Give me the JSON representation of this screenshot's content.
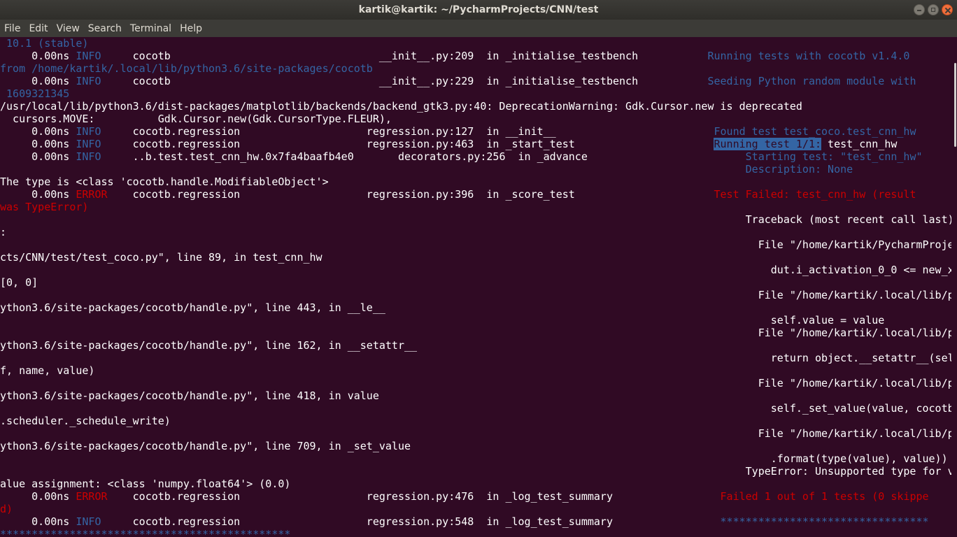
{
  "window": {
    "title": "kartik@kartik: ~/PycharmProjects/CNN/test"
  },
  "menu": [
    "File",
    "Edit",
    "View",
    "Search",
    "Terminal",
    "Help"
  ],
  "terminal_lines": [
    [
      [
        " 10.1 (stable)",
        "b"
      ]
    ],
    [
      [
        "     0.00ns ",
        "w"
      ],
      [
        "INFO",
        "b"
      ],
      [
        "     cocotb                                 __init__.py:209  in _initialise_testbench           ",
        "w"
      ],
      [
        "Running tests with cocotb v1.4.0",
        "b"
      ]
    ],
    [
      [
        "from /home/kartik/.local/lib/python3.6/site-packages/cocotb",
        "b"
      ]
    ],
    [
      [
        "     0.00ns ",
        "w"
      ],
      [
        "INFO",
        "b"
      ],
      [
        "     cocotb                                 __init__.py:229  in _initialise_testbench           ",
        "w"
      ],
      [
        "Seeding Python random module with",
        "b"
      ]
    ],
    [
      [
        " 1609321345",
        "b"
      ]
    ],
    [
      [
        "/usr/local/lib/python3.6/dist-packages/matplotlib/backends/backend_gtk3.py:40: DeprecationWarning: Gdk.Cursor.new is deprecated",
        "w"
      ]
    ],
    [
      [
        "  cursors.MOVE:          Gdk.Cursor.new(Gdk.CursorType.FLEUR),",
        "w"
      ]
    ],
    [
      [
        "     0.00ns ",
        "w"
      ],
      [
        "INFO",
        "b"
      ],
      [
        "     cocotb.regression                    regression.py:127  in __init__                         ",
        "w"
      ],
      [
        "Found test test_coco.test_cnn_hw",
        "b"
      ]
    ],
    [
      [
        "     0.00ns ",
        "w"
      ],
      [
        "INFO",
        "b"
      ],
      [
        "     cocotb.regression                    regression.py:463  in _start_test                      ",
        "w"
      ],
      [
        "Running test 1/1:",
        "hl"
      ],
      [
        " test_cnn_hw",
        "w"
      ]
    ],
    [
      [
        "     0.00ns ",
        "w"
      ],
      [
        "INFO",
        "b"
      ],
      [
        "     ..b.test.test_cnn_hw.0x7fa4baafb4e0       decorators.py:256  in _advance                         ",
        "w"
      ],
      [
        "Starting test: \"test_cnn_hw\"",
        "b"
      ]
    ],
    [
      [
        "                                                                                                                      ",
        "w"
      ],
      [
        "Description: None",
        "b"
      ]
    ],
    [
      [
        "The type is <class 'cocotb.handle.ModifiableObject'>",
        "w"
      ]
    ],
    [
      [
        "     0.00ns ",
        "w"
      ],
      [
        "ERROR",
        "r"
      ],
      [
        "    cocotb.regression                    regression.py:396  in _score_test                      ",
        "w"
      ],
      [
        "Test Failed: test_cnn_hw (result",
        "r"
      ]
    ],
    [
      [
        "was TypeError)",
        "r"
      ]
    ],
    [
      [
        "                                                                                                                      Traceback (most recent call last)",
        "w"
      ]
    ],
    [
      [
        ":",
        "w"
      ]
    ],
    [
      [
        "                                                                                                                        File \"/home/kartik/PycharmProje",
        "w"
      ]
    ],
    [
      [
        "cts/CNN/test/test_coco.py\", line 89, in test_cnn_hw",
        "w"
      ]
    ],
    [
      [
        "                                                                                                                          dut.i_activation_0_0 <= new_x",
        "w"
      ]
    ],
    [
      [
        "[0, 0]",
        "w"
      ]
    ],
    [
      [
        "                                                                                                                        File \"/home/kartik/.local/lib/p",
        "w"
      ]
    ],
    [
      [
        "ython3.6/site-packages/cocotb/handle.py\", line 443, in __le__",
        "w"
      ]
    ],
    [
      [
        "                                                                                                                          self.value = value",
        "w"
      ]
    ],
    [
      [
        "                                                                                                                        File \"/home/kartik/.local/lib/p",
        "w"
      ]
    ],
    [
      [
        "ython3.6/site-packages/cocotb/handle.py\", line 162, in __setattr__",
        "w"
      ]
    ],
    [
      [
        "                                                                                                                          return object.__setattr__(sel",
        "w"
      ]
    ],
    [
      [
        "f, name, value)",
        "w"
      ]
    ],
    [
      [
        "                                                                                                                        File \"/home/kartik/.local/lib/p",
        "w"
      ]
    ],
    [
      [
        "ython3.6/site-packages/cocotb/handle.py\", line 418, in value",
        "w"
      ]
    ],
    [
      [
        "                                                                                                                          self._set_value(value, cocotb",
        "w"
      ]
    ],
    [
      [
        ".scheduler._schedule_write)",
        "w"
      ]
    ],
    [
      [
        "                                                                                                                        File \"/home/kartik/.local/lib/p",
        "w"
      ]
    ],
    [
      [
        "ython3.6/site-packages/cocotb/handle.py\", line 709, in _set_value",
        "w"
      ]
    ],
    [
      [
        "                                                                                                                          .format(type(value), value))",
        "w"
      ]
    ],
    [
      [
        "                                                                                                                      TypeError: Unsupported type for v",
        "w"
      ]
    ],
    [
      [
        "alue assignment: <class 'numpy.float64'> (0.0)",
        "w"
      ]
    ],
    [
      [
        "     0.00ns ",
        "w"
      ],
      [
        "ERROR",
        "r"
      ],
      [
        "    cocotb.regression                    regression.py:476  in _log_test_summary                 ",
        "w"
      ],
      [
        "Failed 1 out of 1 tests (0 skippe",
        "r"
      ]
    ],
    [
      [
        "d)",
        "r"
      ]
    ],
    [
      [
        "     0.00ns ",
        "w"
      ],
      [
        "INFO",
        "b"
      ],
      [
        "     cocotb.regression                    regression.py:548  in _log_test_summary                 ",
        "w"
      ],
      [
        "*********************************",
        "b"
      ]
    ],
    [
      [
        "**********************************************",
        "b"
      ]
    ]
  ]
}
